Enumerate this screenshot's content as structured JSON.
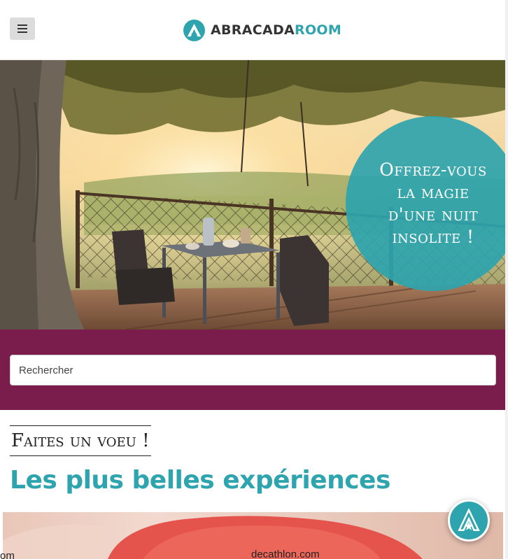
{
  "header": {
    "menu_label": "Menu",
    "logo_part1": "ABRACADA",
    "logo_part2": "ROOM"
  },
  "hero": {
    "tagline": "Offrez-vous la magie d'une nuit insolite !"
  },
  "search": {
    "placeholder": "Rechercher"
  },
  "main": {
    "wish_heading": "Faites un voeu !",
    "section_title": "Les plus belles expériences",
    "card_caption_left": "om",
    "card_caption": "decathlon.com"
  },
  "colors": {
    "brand_teal": "#2ea4ae",
    "band_plum": "#7a1d4d",
    "dark_text": "#333333"
  },
  "icons": {
    "menu": "hamburger-icon",
    "logo": "tipi-star-icon",
    "fab": "tipi-star-icon"
  }
}
